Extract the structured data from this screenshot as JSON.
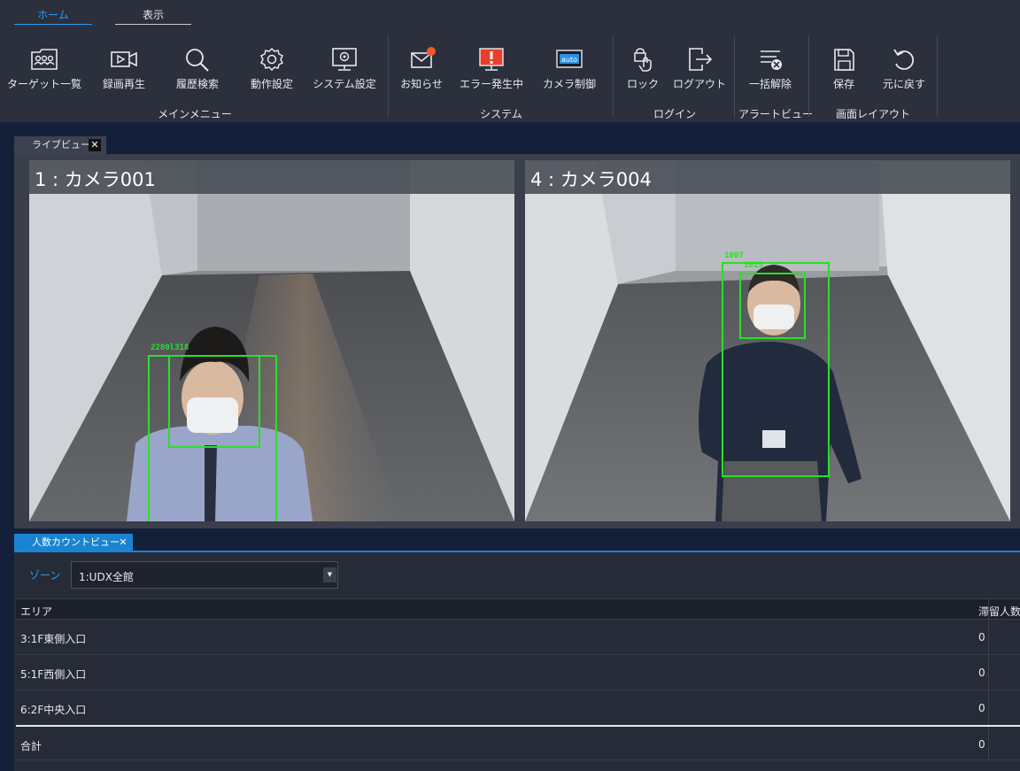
{
  "ribbon": {
    "tabs": [
      {
        "label": "ホーム",
        "active": true
      },
      {
        "label": "表示",
        "active": false
      }
    ],
    "groups": {
      "main_menu": {
        "label": "メインメニュー",
        "buttons": [
          {
            "label": "ターゲット一覧",
            "icon": "target-list-icon"
          },
          {
            "label": "録画再生",
            "icon": "playback-icon"
          },
          {
            "label": "履歴検索",
            "icon": "search-icon"
          },
          {
            "label": "動作設定",
            "icon": "gear-icon"
          },
          {
            "label": "システム設定",
            "icon": "system-settings-icon"
          }
        ]
      },
      "system": {
        "label": "システム",
        "buttons": [
          {
            "label": "お知らせ",
            "icon": "mail-icon"
          },
          {
            "label": "エラー発生中",
            "icon": "error-monitor-icon"
          },
          {
            "label": "カメラ制御",
            "icon": "camera-control-icon",
            "badge": "auto"
          }
        ]
      },
      "login": {
        "label": "ログイン",
        "buttons": [
          {
            "label": "ロック",
            "icon": "lock-icon"
          },
          {
            "label": "ログアウト",
            "icon": "logout-icon"
          }
        ]
      },
      "alert_view": {
        "label": "アラートビュー",
        "buttons": [
          {
            "label": "一括解除",
            "icon": "clear-all-icon"
          }
        ]
      },
      "screen_layout": {
        "label": "画面レイアウト",
        "buttons": [
          {
            "label": "保存",
            "icon": "save-icon"
          },
          {
            "label": "元に戻す",
            "icon": "undo-icon"
          }
        ]
      }
    }
  },
  "live_view": {
    "tab_label": "ライブビュー",
    "close_glyph": "✕",
    "cameras": [
      {
        "title": "1 : カメラ001",
        "detections": [
          "2280l318"
        ]
      },
      {
        "title": "4 : カメラ004",
        "detections": [
          "1007",
          "1015"
        ]
      }
    ]
  },
  "people_count": {
    "tab_label": "人数カウントビュー",
    "close_glyph": "✕",
    "zone_label": "ゾーン",
    "zone_value": "1:UDX全館",
    "zone_arrow": "▼",
    "columns": {
      "area": "エリア",
      "count": "滞留人数"
    },
    "rows": [
      {
        "area": "3:1F東側入口",
        "count": "0"
      },
      {
        "area": "5:1F西側入口",
        "count": "0"
      },
      {
        "area": "6:2F中央入口",
        "count": "0"
      }
    ],
    "total": {
      "area": "合計",
      "count": "0"
    }
  },
  "colors": {
    "accent": "#2d9bf0",
    "tab_active": "#1b84d2",
    "detection": "#28e028",
    "notification_dot": "#f05a28",
    "error_red": "#e8402a"
  }
}
